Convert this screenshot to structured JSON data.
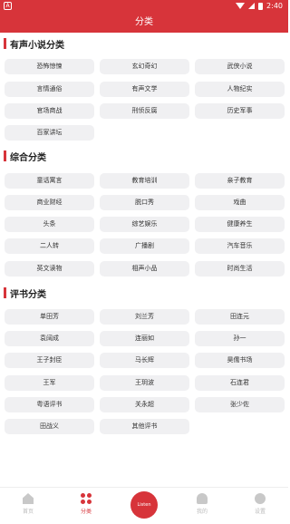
{
  "status_bar": {
    "time": "2:40",
    "app_icon_glyph": "A"
  },
  "header": {
    "title": "分类"
  },
  "sections": [
    {
      "title": "有声小说分类",
      "items": [
        "恐怖惊悚",
        "玄幻奇幻",
        "武侠小说",
        "言情通俗",
        "有声文学",
        "人物纪实",
        "官场商战",
        "刑侦反腐",
        "历史军事",
        "百家讲坛"
      ]
    },
    {
      "title": "综合分类",
      "items": [
        "童话寓言",
        "教育培训",
        "亲子教育",
        "商业财经",
        "脱口秀",
        "戏曲",
        "头条",
        "综艺娱乐",
        "健康养生",
        "二人转",
        "广播剧",
        "汽车音乐",
        "英文读物",
        "相声小品",
        "时尚生活"
      ]
    },
    {
      "title": "评书分类",
      "items": [
        "单田芳",
        "刘兰芳",
        "田连元",
        "袁阔成",
        "连丽如",
        "孙一",
        "王子封臣",
        "马长辉",
        "昊儒书场",
        "王军",
        "王玥波",
        "石连君",
        "粤语评书",
        "关永超",
        "张少佐",
        "田战义",
        "其他评书"
      ]
    }
  ],
  "bottom_nav": {
    "items": [
      "首页",
      "分类",
      "",
      "我的",
      "设置"
    ],
    "center_label": "Listen",
    "active_index": 1
  },
  "colors": {
    "accent": "#d7343a",
    "chip_bg": "#f0f0f2"
  }
}
